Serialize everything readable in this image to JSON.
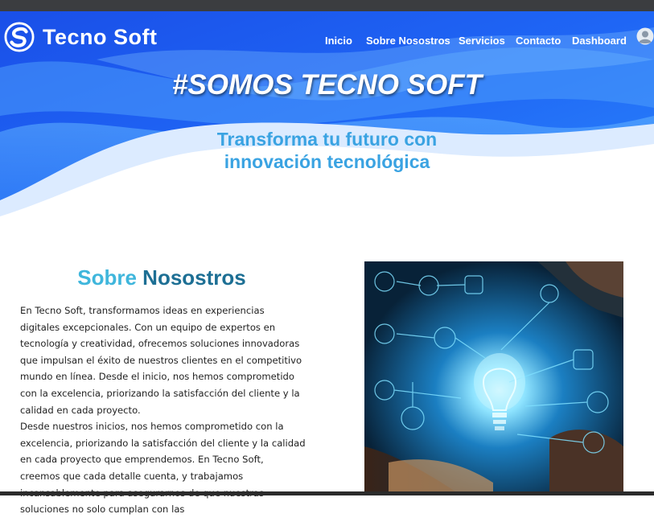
{
  "brand": {
    "name": "Tecno Soft"
  },
  "nav": {
    "items": [
      {
        "label": "Inicio"
      },
      {
        "label": "Sobre Nosostros"
      },
      {
        "label": "Servicios"
      },
      {
        "label": "Contacto"
      },
      {
        "label": "Dashboard"
      }
    ]
  },
  "hero": {
    "title": "#SOMOS TECNO SOFT",
    "subtitle_line1": "Transforma tu futuro con",
    "subtitle_line2": "innovación tecnológica"
  },
  "about": {
    "title_part1": "Sobre",
    "title_part2": "Nosostros",
    "paragraph1": "En Tecno Soft, transformamos ideas en experiencias digitales excepcionales. Con un equipo de expertos en tecnología y creatividad, ofrecemos soluciones innovadoras que impulsan el éxito de nuestros clientes en el competitivo mundo en línea. Desde el inicio, nos hemos comprometido con la excelencia, priorizando la satisfacción del cliente y la calidad en cada proyecto.",
    "paragraph2": "Desde nuestros inicios, nos hemos comprometido con la excelencia, priorizando la satisfacción del cliente y la calidad en cada proyecto que emprendemos. En Tecno Soft, creemos que cada detalle cuenta, y trabajamos incansablemente para asegurarnos de que nuestras soluciones no solo cumplan con las"
  },
  "icons": {
    "logo": "tecnosoft-logo-icon",
    "avatar": "user-avatar-icon",
    "image": "tech-lightbulb-image"
  },
  "colors": {
    "hero_blue": "#1e5ef2",
    "accent": "#3aa3e2",
    "title_light": "#3fb6dc",
    "title_dark": "#1d6f94"
  }
}
